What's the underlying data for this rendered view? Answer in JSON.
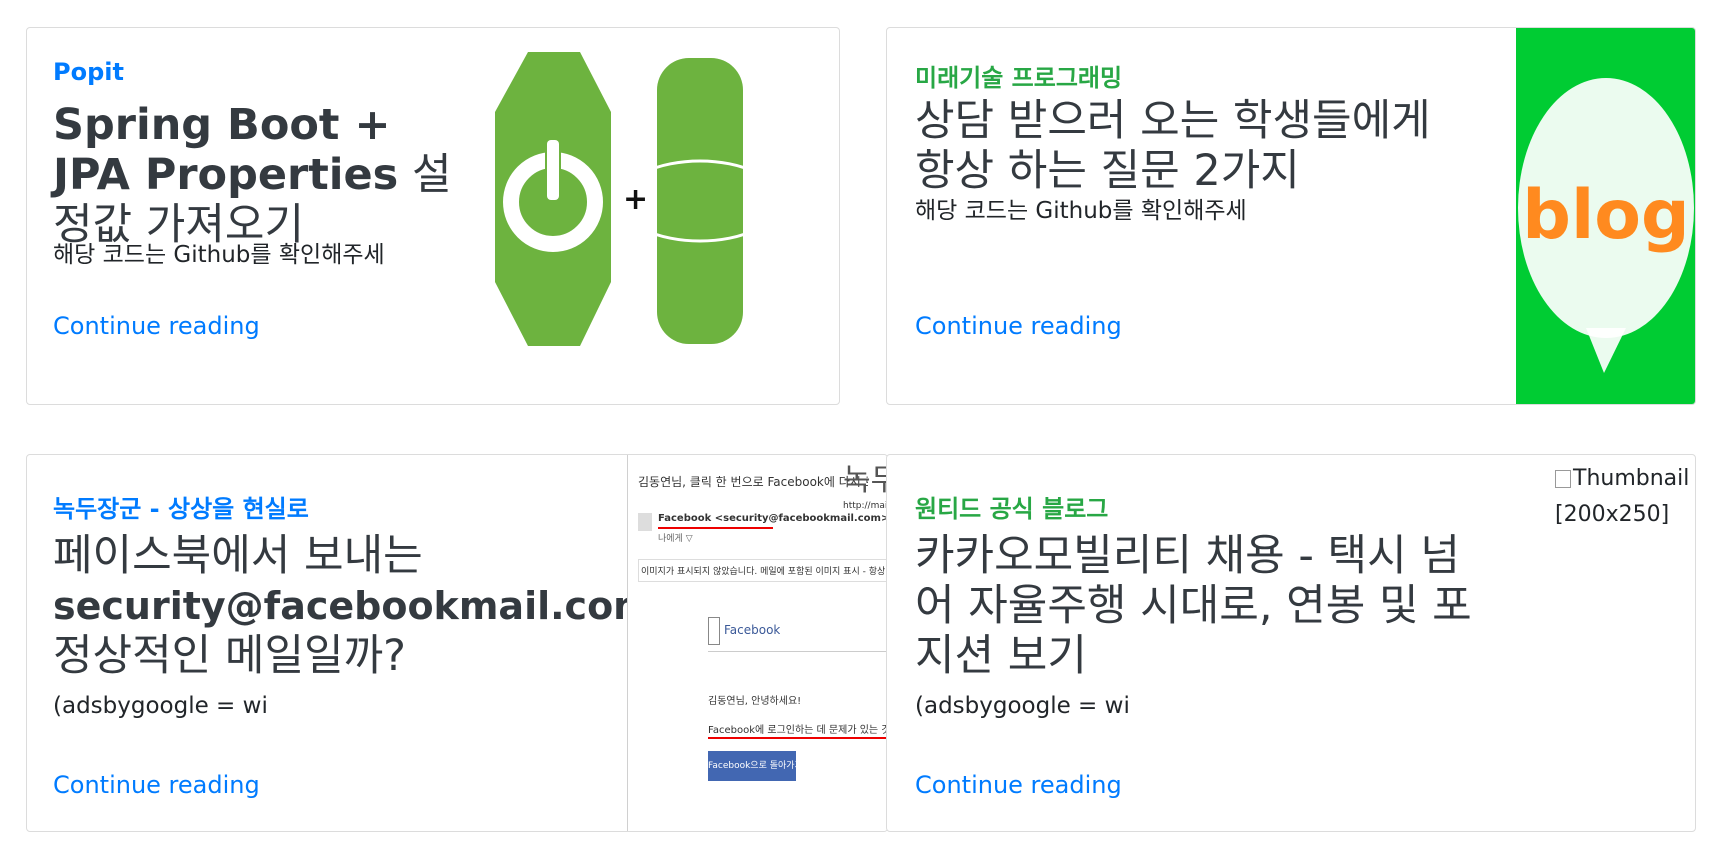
{
  "cards": [
    {
      "category": "Popit",
      "title_bold": "Spring Boot + JPA Properties",
      "title_rest": " 설정값 가져오기",
      "snippet": "해당 코드는 Github를 확인해주세",
      "more": "Continue reading",
      "thumbnail": "spring-boot-jpa-logo"
    },
    {
      "category": "미래기술 프로그래밍",
      "title": "상담 받으러 오는 학생들에게 항상 하는 질문 2가지",
      "snippet": "해당 코드는 Github를 확인해주세",
      "more": "Continue reading",
      "thumbnail": "blog-logo",
      "thumb_text": "blog"
    },
    {
      "category": "녹두장군 - 상상을 현실로",
      "title_line1": "페이스북에서 보내는",
      "title_bold": "security@facebookmail.com",
      "title_line3": "정상적인 메일일까?",
      "snippet": "(adsbygoogle = wi",
      "more": "Continue reading",
      "thumbnail": "facebook-email-screenshot",
      "shot": {
        "header": "김동연님, 클릭 한 번으로 Facebook에 다시 로그인하세요",
        "watermark": "녹두",
        "url": "http://mainia",
        "sender": "Facebook <security@facebookmail.com>",
        "to": "나에게 ▽",
        "notice": "이미지가 표시되지 않았습니다. 메일에 포함된 이미지 표시 - 항상 security@",
        "brand": "Facebook",
        "greeting": "김동연님, 안녕하세요!",
        "body": "Facebook에 로그인하는 데 문제가 있는 것 같습니다",
        "button": "Facebook으로 돌아가기"
      }
    },
    {
      "category": "원티드 공식 블로그",
      "title": "카카오모빌리티 채용 - 택시 넘어 자율주행 시대로, 연봉 및 포지션 보기",
      "snippet": "(adsbygoogle = wi",
      "more": "Continue reading",
      "thumb_alt": "Thumbnail",
      "thumb_size": "[200x250]"
    }
  ],
  "colors": {
    "link": "#007bff",
    "category_green": "#28a745",
    "spring_green": "#6db33f",
    "blog_bg": "#00cc33",
    "blog_text": "#ff8a1f"
  }
}
